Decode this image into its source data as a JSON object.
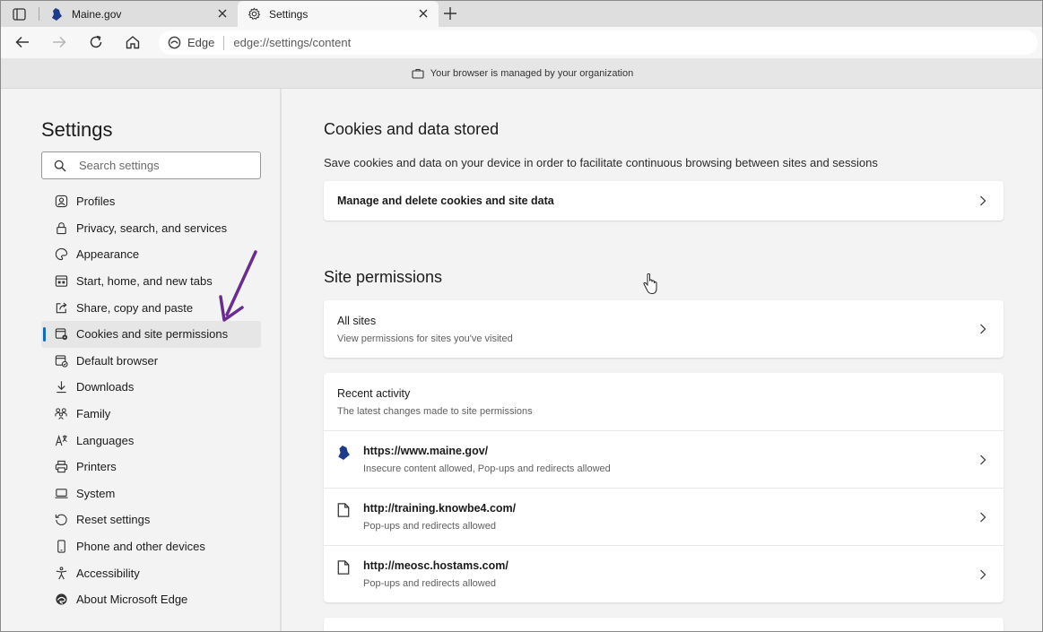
{
  "tabs": [
    {
      "label": "Maine.gov",
      "icon": "maine-gov-favicon"
    },
    {
      "label": "Settings",
      "icon": "gear-icon"
    }
  ],
  "toolbar": {
    "omnibox_label": "Edge",
    "url": "edge://settings/content"
  },
  "managed_banner": "Your browser is managed by your organization",
  "sidebar": {
    "title": "Settings",
    "search_placeholder": "Search settings",
    "items": [
      {
        "label": "Profiles",
        "icon": "profile-icon"
      },
      {
        "label": "Privacy, search, and services",
        "icon": "lock-icon"
      },
      {
        "label": "Appearance",
        "icon": "palette-icon"
      },
      {
        "label": "Start, home, and new tabs",
        "icon": "start-tabs-icon"
      },
      {
        "label": "Share, copy and paste",
        "icon": "share-icon"
      },
      {
        "label": "Cookies and site permissions",
        "icon": "cookies-icon",
        "active": true
      },
      {
        "label": "Default browser",
        "icon": "default-browser-icon"
      },
      {
        "label": "Downloads",
        "icon": "download-icon"
      },
      {
        "label": "Family",
        "icon": "family-icon"
      },
      {
        "label": "Languages",
        "icon": "languages-icon"
      },
      {
        "label": "Printers",
        "icon": "printer-icon"
      },
      {
        "label": "System",
        "icon": "system-icon"
      },
      {
        "label": "Reset settings",
        "icon": "reset-icon"
      },
      {
        "label": "Phone and other devices",
        "icon": "phone-icon"
      },
      {
        "label": "Accessibility",
        "icon": "accessibility-icon"
      },
      {
        "label": "About Microsoft Edge",
        "icon": "edge-logo-icon"
      }
    ]
  },
  "main": {
    "cookies_heading": "Cookies and data stored",
    "cookies_desc": "Save cookies and data on your device in order to facilitate continuous browsing between sites and sessions",
    "manage_cookies_label": "Manage and delete cookies and site data",
    "permissions_heading": "Site permissions",
    "all_sites_title": "All sites",
    "all_sites_sub": "View permissions for sites you've visited",
    "recent_title": "Recent activity",
    "recent_sub": "The latest changes made to site permissions",
    "recent_sites": [
      {
        "url": "https://www.maine.gov/",
        "detail": "Insecure content allowed, Pop-ups and redirects allowed",
        "icon": "maine-gov-favicon"
      },
      {
        "url": "http://training.knowbe4.com/",
        "detail": "Pop-ups and redirects allowed",
        "icon": "page-icon"
      },
      {
        "url": "http://meosc.hostams.com/",
        "detail": "Pop-ups and redirects allowed",
        "icon": "page-icon"
      }
    ]
  },
  "colors": {
    "accent": "#0f6cbd",
    "annotation_arrow": "#6a2c91"
  }
}
